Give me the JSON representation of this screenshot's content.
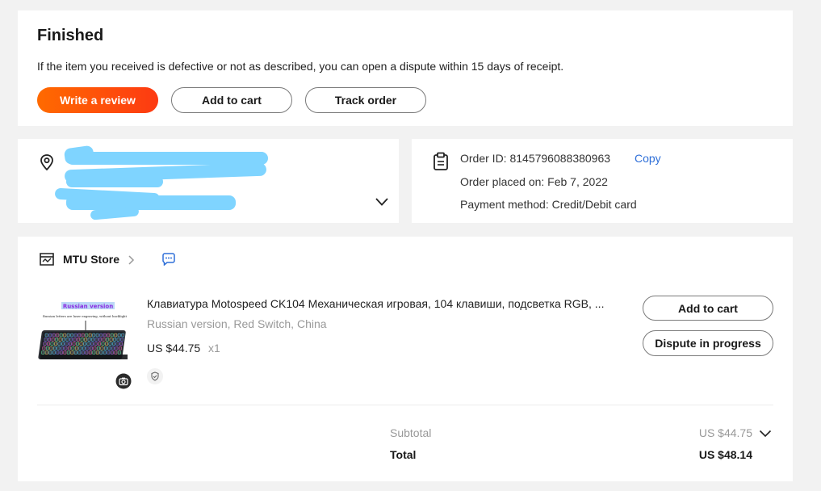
{
  "status": {
    "title": "Finished",
    "description": "If the item you received is defective or not as described, you can open a dispute within 15 days of receipt.",
    "buttons": {
      "review": "Write a review",
      "add_to_cart": "Add to cart",
      "track": "Track order"
    }
  },
  "address": {
    "icon": "location-pin-icon",
    "redacted": true
  },
  "order_info": {
    "order_id_text": "Order ID: 8145796088380963",
    "copy_label": "Copy",
    "placed_text": "Order placed on: Feb 7, 2022",
    "payment_text": "Payment method: Credit/Debit card"
  },
  "store": {
    "name": "MTU Store",
    "icons": [
      "store-icon",
      "chevron-right-icon",
      "chat-icon"
    ]
  },
  "item": {
    "thumb_caption": "Russian version",
    "thumb_subcaption": "Russian letters are laser engraving, without backlight",
    "title": "Клавиатура Motospeed CK104 Механическая игровая, 104 клавиши, подсветка RGB, ...",
    "variant": "Russian version, Red Switch, China",
    "price": "US $44.75",
    "quantity": "x1",
    "buttons": {
      "add_to_cart": "Add to cart",
      "dispute": "Dispute in progress"
    }
  },
  "summary": {
    "subtotal_label": "Subtotal",
    "subtotal_value": "US $44.75",
    "total_label": "Total",
    "total_value": "US $48.14"
  },
  "colors": {
    "accent_start": "#ff6a00",
    "accent_end": "#fd3a12",
    "link": "#2e6fd8",
    "redaction": "#7fd4ff"
  }
}
